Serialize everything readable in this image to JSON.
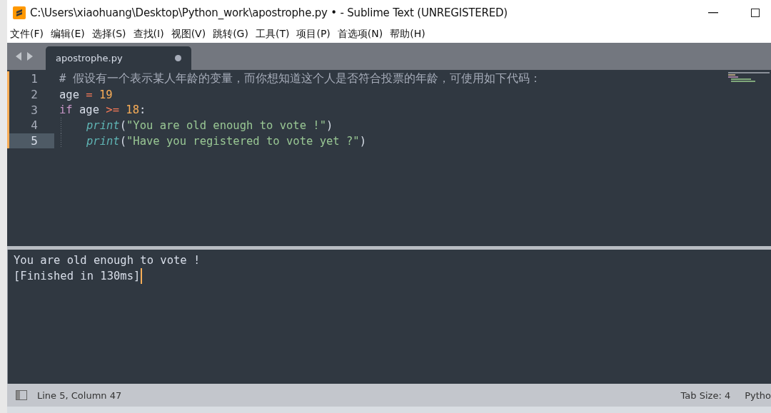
{
  "window": {
    "title": "C:\\Users\\xiaohuang\\Desktop\\Python_work\\apostrophe.py • - Sublime Text (UNREGISTERED)"
  },
  "menu": [
    "文件(F)",
    "编辑(E)",
    "选择(S)",
    "查找(I)",
    "视图(V)",
    "跳转(G)",
    "工具(T)",
    "项目(P)",
    "首选项(N)",
    "帮助(H)"
  ],
  "tabs": [
    {
      "label": "apostrophe.py",
      "selected": true,
      "modified": true
    }
  ],
  "editor": {
    "lines": [
      {
        "number": "1",
        "current": false,
        "modified": true,
        "indented": false,
        "tokens": [
          {
            "kind": "comment",
            "text": "# 假设有一个表示某人年龄的变量，而你想知道这个人是否符合投票的年龄，可使用如下代码："
          }
        ]
      },
      {
        "number": "2",
        "current": false,
        "modified": true,
        "indented": false,
        "tokens": [
          {
            "kind": "name",
            "text": "age "
          },
          {
            "kind": "operator",
            "text": "="
          },
          {
            "kind": "number",
            "text": " 19"
          }
        ]
      },
      {
        "number": "3",
        "current": false,
        "modified": true,
        "indented": false,
        "tokens": [
          {
            "kind": "keyword",
            "text": "if"
          },
          {
            "kind": "name",
            "text": " age "
          },
          {
            "kind": "operator",
            "text": ">="
          },
          {
            "kind": "number",
            "text": " 18"
          },
          {
            "kind": "plain",
            "text": ":"
          }
        ]
      },
      {
        "number": "4",
        "current": false,
        "modified": true,
        "indented": true,
        "tokens": [
          {
            "kind": "function",
            "text": "print"
          },
          {
            "kind": "plain",
            "text": "("
          },
          {
            "kind": "string",
            "text": "\"You are old enough to vote !\""
          },
          {
            "kind": "plain",
            "text": ")"
          }
        ]
      },
      {
        "number": "5",
        "current": true,
        "modified": true,
        "indented": true,
        "tokens": [
          {
            "kind": "function",
            "text": "print"
          },
          {
            "kind": "plain",
            "text": "("
          },
          {
            "kind": "string",
            "text": "\"Have you registered to vote yet ?\""
          },
          {
            "kind": "plain",
            "text": ")"
          }
        ]
      }
    ]
  },
  "output": {
    "lines": [
      "You are old enough to vote !",
      "[Finished in 130ms]"
    ]
  },
  "status_bar": {
    "position": "Line 5, Column 47",
    "tab_size": "Tab Size: 4",
    "syntax": "Pytho"
  }
}
